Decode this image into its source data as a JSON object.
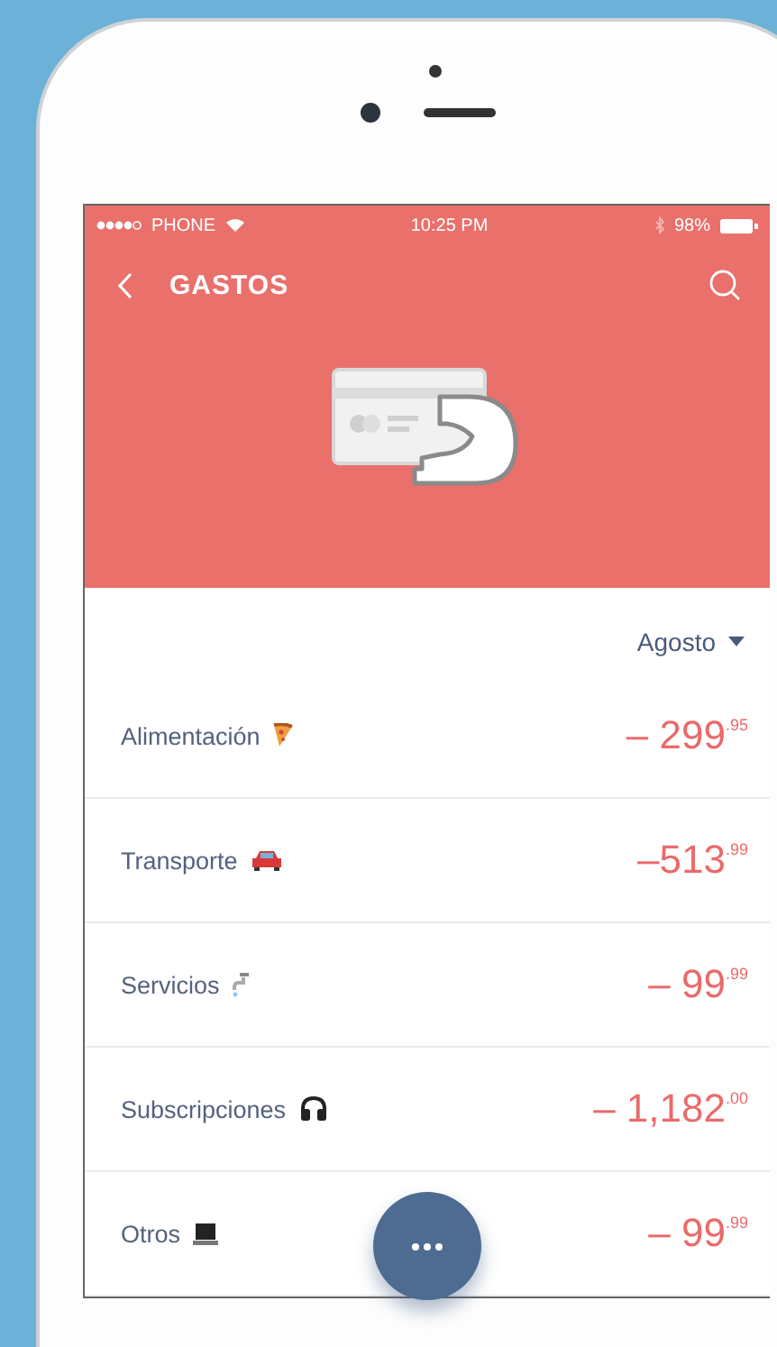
{
  "status_bar": {
    "carrier": "PHONE",
    "time": "10:25 PM",
    "battery": "98%"
  },
  "header": {
    "title": "GASTOS"
  },
  "month_selector": {
    "label": "Agosto"
  },
  "expenses": [
    {
      "name": "Alimentación",
      "kind": "food",
      "amount": "– 299$^{.95}$"
    },
    {
      "name": "Transporte",
      "kind": "car",
      "amount": "–513$^{.99}$"
    },
    {
      "name": "Servicios",
      "kind": "faucet",
      "amount": "– 99$^{.99}$"
    },
    {
      "name": "Subscripciones",
      "kind": "headphones",
      "amount": "– 1,182$^{.00}$"
    },
    {
      "name": "Otros",
      "kind": "laptop",
      "amount": "– 99$^{.99}$"
    }
  ]
}
